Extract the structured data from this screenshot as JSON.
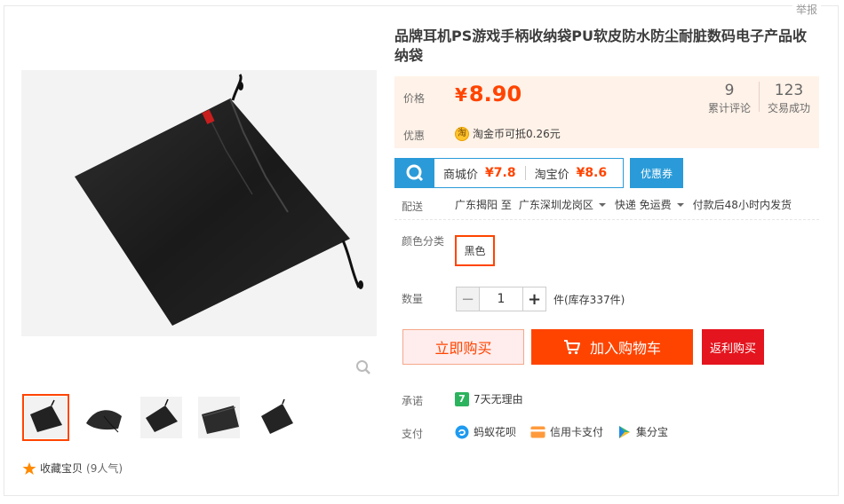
{
  "report_label": "举报",
  "product": {
    "title": "品牌耳机PS游戏手柄收纳袋PU软皮防水防尘耐脏数码电子产品收纳袋"
  },
  "price": {
    "label": "价格",
    "currency": "¥",
    "value": "8.90",
    "reviews_count": "9",
    "reviews_label": "累计评论",
    "sales_count": "123",
    "sales_label": "交易成功"
  },
  "promo": {
    "label": "优惠",
    "coin_icon_text": "淘",
    "text": "淘金币可抵",
    "amount": "0.26元"
  },
  "compare": {
    "mall_label": "商城价",
    "mall_price": "¥7.8",
    "taobao_label": "淘宝价",
    "taobao_price": "¥8.6",
    "coupon_button": "优惠券"
  },
  "delivery": {
    "label": "配送",
    "from": "广东揭阳 至",
    "to": "广东深圳龙岗区",
    "shipping": "快递 免运费",
    "dispatch": "付款后48小时内发货"
  },
  "color": {
    "label": "颜色分类",
    "selected": "黑色"
  },
  "quantity": {
    "label": "数量",
    "minus": "−",
    "value": "1",
    "plus": "+",
    "stock": "件(库存337件)"
  },
  "actions": {
    "buy_now": "立即购买",
    "add_to_cart": "加入购物车",
    "rebate_buy": "返利购买"
  },
  "promise": {
    "label": "承诺",
    "icon_text": "7",
    "text": "7天无理由"
  },
  "payment": {
    "label": "支付",
    "methods": [
      "蚂蚁花呗",
      "信用卡支付",
      "集分宝"
    ]
  },
  "favorite": {
    "label": "收藏宝贝",
    "count": "(9人气)"
  },
  "colors": {
    "accent": "#ff4400",
    "price_bg": "#fff2e8",
    "compare_blue": "#2a9bd8",
    "rebate_red": "#e4151e"
  },
  "icons": [
    "search-zoom-icon",
    "star-icon",
    "cart-icon",
    "huabei-icon",
    "credit-card-icon",
    "jifenbao-icon"
  ]
}
